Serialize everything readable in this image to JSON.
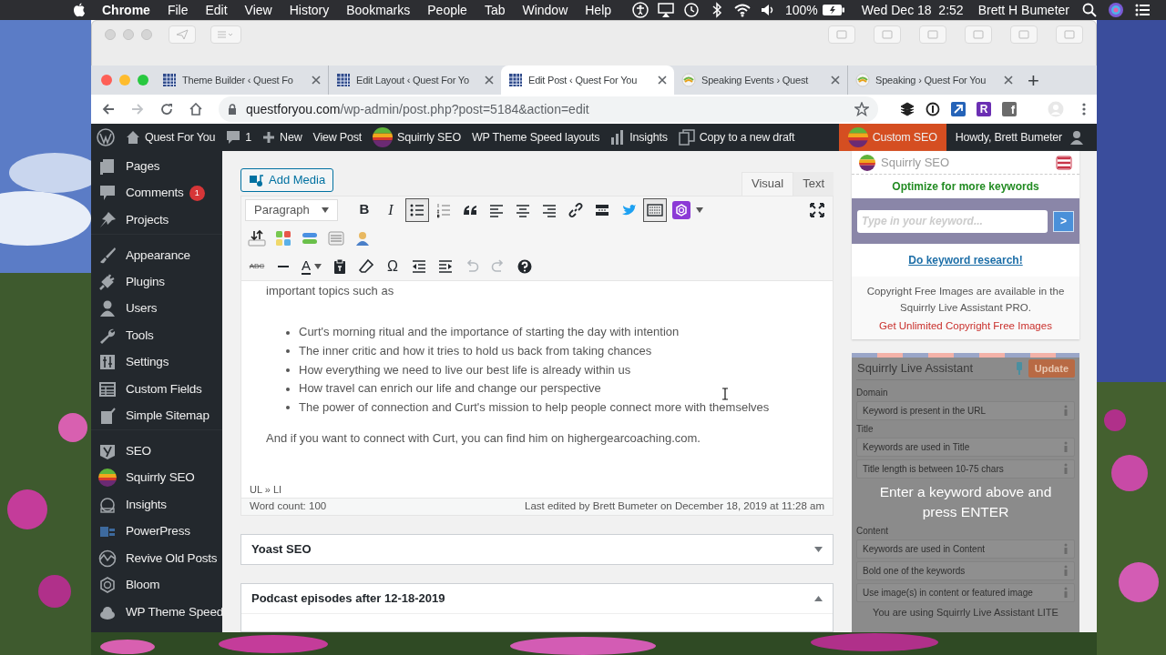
{
  "menu_bar": {
    "app": "Chrome",
    "menus": [
      "File",
      "Edit",
      "View",
      "History",
      "Bookmarks",
      "People",
      "Tab",
      "Window",
      "Help"
    ],
    "battery": "100%",
    "clock": "Wed Dec 18  2:52",
    "user": "Brett H Bumeter"
  },
  "browser": {
    "tabs": [
      {
        "title": "Theme Builder ‹ Quest Fo",
        "selected": false
      },
      {
        "title": "Edit Layout ‹ Quest For Yo",
        "selected": false
      },
      {
        "title": "Edit Post ‹ Quest For You",
        "selected": true
      },
      {
        "title": "Speaking Events › Quest",
        "selected": false
      },
      {
        "title": "Speaking › Quest For You",
        "selected": false
      }
    ],
    "new_tab": "+",
    "url_host": "questforyou.com",
    "url_path": "/wp-admin/post.php?post=5184&action=edit",
    "extension_letters": [
      "R",
      "f"
    ]
  },
  "admin_bar": {
    "items": [
      {
        "label": "Quest For You",
        "selected": false
      },
      {
        "label": "1",
        "selected": false
      },
      {
        "label": "New",
        "selected": false
      },
      {
        "label": "View Post",
        "selected": false
      },
      {
        "label": "Squirrly SEO",
        "selected": false
      },
      {
        "label": "WP Theme Speed layouts",
        "selected": false
      },
      {
        "label": "Insights",
        "selected": false
      },
      {
        "label": "Copy to a new draft",
        "selected": false
      },
      {
        "label": "Custom SEO",
        "selected": true
      }
    ],
    "account": "Howdy, Brett Bumeter"
  },
  "sidebar": {
    "items": [
      {
        "label": "Pages"
      },
      {
        "label": "Comments",
        "badge": "1"
      },
      {
        "label": "Projects"
      },
      {
        "label": "Appearance",
        "group_start": true
      },
      {
        "label": "Plugins"
      },
      {
        "label": "Users"
      },
      {
        "label": "Tools"
      },
      {
        "label": "Settings"
      },
      {
        "label": "Custom Fields"
      },
      {
        "label": "Simple Sitemap"
      },
      {
        "label": "SEO",
        "group_start": true
      },
      {
        "label": "Squirrly SEO"
      },
      {
        "label": "Insights"
      },
      {
        "label": "PowerPress"
      },
      {
        "label": "Revive Old Posts"
      },
      {
        "label": "Bloom"
      },
      {
        "label": "WP Theme Speed"
      }
    ]
  },
  "editor": {
    "add_media": "Add Media",
    "mode_tabs": [
      {
        "label": "Visual",
        "selected": true
      },
      {
        "label": "Text",
        "selected": false
      }
    ],
    "toolbar": {
      "format": "Paragraph",
      "bold": "B",
      "italic": "I",
      "bulleted_list": {
        "selected": true
      },
      "kitchen_sink": {
        "selected": true
      },
      "strikethrough": "ABC",
      "text_color": "A",
      "special_character": "Ω",
      "undo": {
        "disabled": true
      },
      "redo": {
        "disabled": true
      }
    },
    "content": {
      "intro": "important topics such as",
      "bullets": [
        "Curt's morning ritual and the importance of starting the day with intention",
        "The inner critic and how it tries to hold us back from taking chances",
        "How everything we need to live our best life is already within us",
        "How travel can enrich our life and change our perspective",
        "The power of connection and Curt's mission to help people connect more with themselves"
      ],
      "closing": "And if you want to connect with Curt, you can find him on highergearcoaching.com."
    },
    "path": "UL » LI",
    "word_count": "Word count: 100",
    "last_edited": "Last edited by Brett Bumeter on December 18, 2019 at 11:28 am"
  },
  "metaboxes": [
    {
      "title": "Yoast SEO",
      "expanded": false
    },
    {
      "title": "Podcast episodes after 12-18-2019",
      "expanded": true
    }
  ],
  "squirrly_panel": {
    "title": "Squirrly SEO",
    "heading": "Optimize for more keywords",
    "keyword_placeholder": "Type in your keyword...",
    "go_button": ">",
    "research_link": "Do keyword research!",
    "notice": "Copyright Free Images are available in the Squirrly Live Assistant PRO.",
    "notice_link": "Get Unlimited Copyright Free Images"
  },
  "live_assistant": {
    "title": "Squirrly Live Assistant",
    "update_button": "Update",
    "sections": [
      {
        "heading": "Domain",
        "checks": [
          "Keyword is present in the URL"
        ]
      },
      {
        "heading": "Title",
        "checks": [
          "Keywords are used in Title",
          "Title length is between 10-75 chars"
        ]
      },
      {
        "heading": "Content",
        "checks": [
          "Keywords are used in Content",
          "Bold one of the keywords",
          "Use image(s) in content or featured image"
        ]
      }
    ],
    "overlay_message": "Enter a keyword above and press ENTER",
    "footer": "You are using Squirrly Live Assistant LITE"
  }
}
